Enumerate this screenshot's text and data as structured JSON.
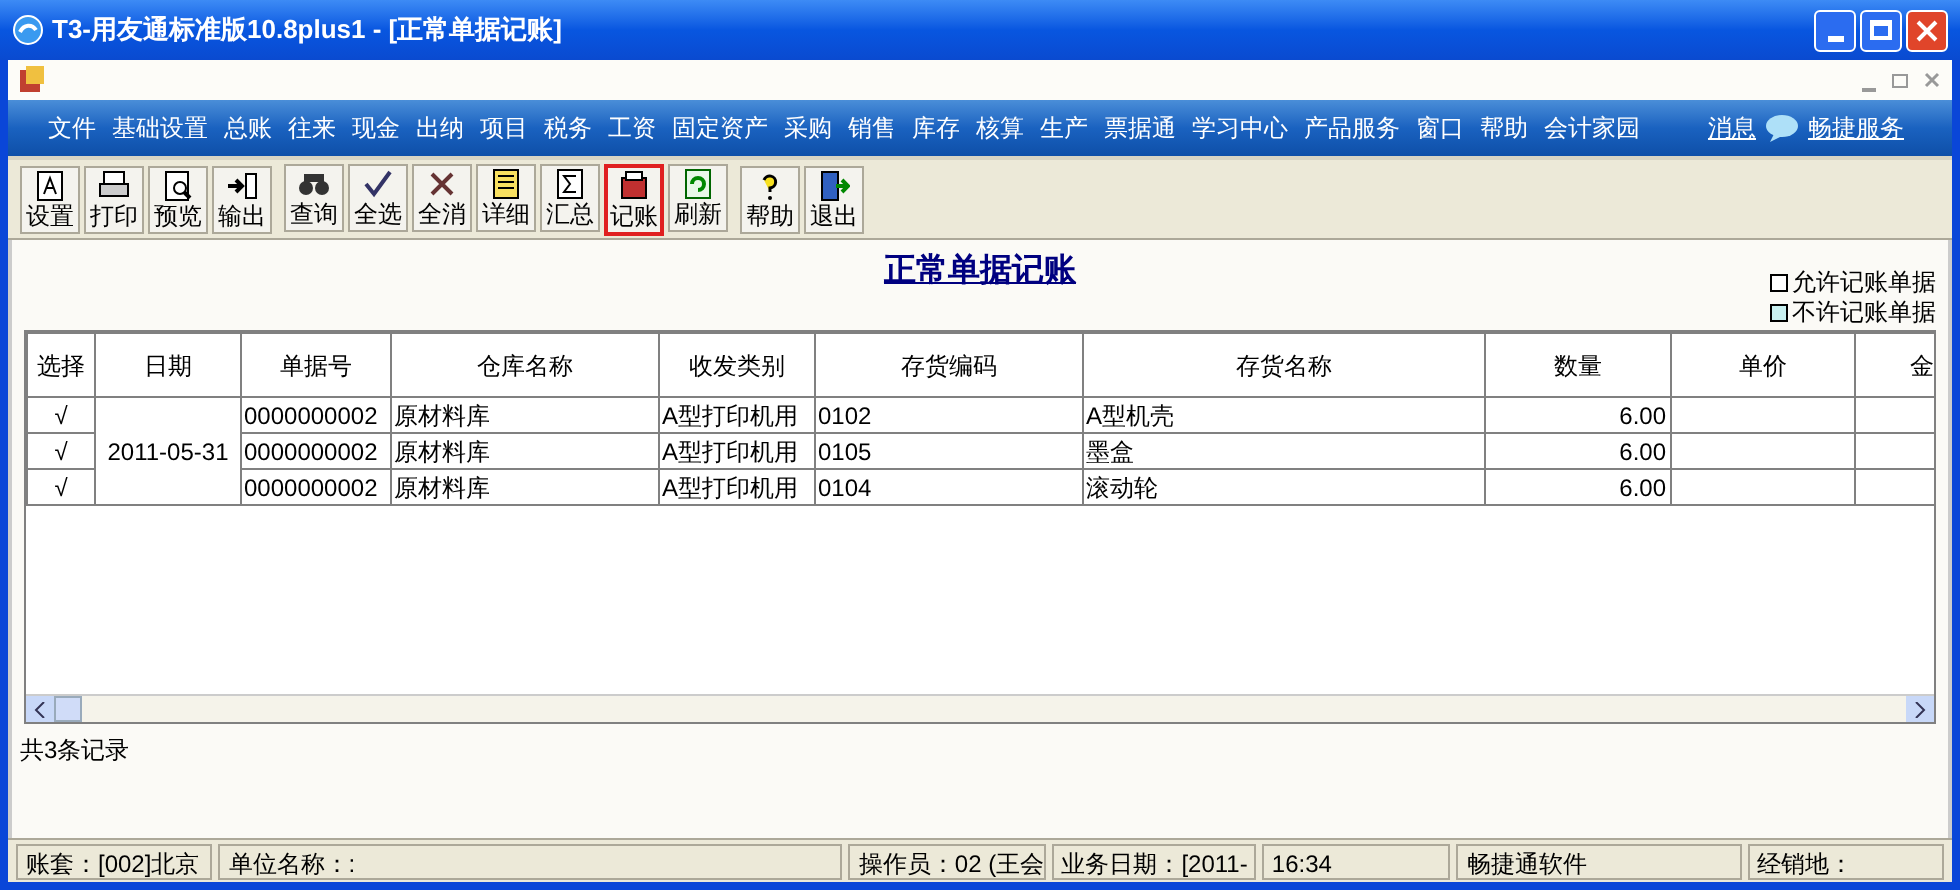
{
  "window": {
    "title": "T3-用友通标准版10.8plus1 - [正常单据记账]"
  },
  "menu": {
    "items": [
      "文件",
      "基础设置",
      "总账",
      "往来",
      "现金",
      "出纳",
      "项目",
      "税务",
      "工资",
      "固定资产",
      "采购",
      "销售",
      "库存",
      "核算",
      "生产",
      "票据通",
      "学习中心",
      "产品服务",
      "窗口",
      "帮助",
      "会计家园"
    ],
    "links": [
      "消息",
      "畅捷服务"
    ]
  },
  "toolbar": {
    "groups": [
      [
        {
          "label": "设置",
          "highlighted": false
        },
        {
          "label": "打印",
          "highlighted": false
        },
        {
          "label": "预览",
          "highlighted": false
        },
        {
          "label": "输出",
          "highlighted": false
        }
      ],
      [
        {
          "label": "查询",
          "highlighted": false
        },
        {
          "label": "全选",
          "highlighted": false
        },
        {
          "label": "全消",
          "highlighted": false
        },
        {
          "label": "详细",
          "highlighted": false
        },
        {
          "label": "汇总",
          "highlighted": false
        },
        {
          "label": "记账",
          "highlighted": true
        },
        {
          "label": "刷新",
          "highlighted": false
        }
      ],
      [
        {
          "label": "帮助",
          "highlighted": false
        },
        {
          "label": "退出",
          "highlighted": false
        }
      ]
    ]
  },
  "heading": "正常单据记账",
  "legend": [
    {
      "label": "允许记账单据",
      "color": "#ffffff"
    },
    {
      "label": "不许记账单据",
      "color": "#c8f0f0"
    }
  ],
  "table": {
    "columns": [
      "选择",
      "日期",
      "单据号",
      "仓库名称",
      "收发类别",
      "存货编码",
      "存货名称",
      "数量",
      "单价",
      "金"
    ],
    "date": "2011-05-31",
    "rows": [
      {
        "select": "√",
        "doc_no": "0000000002",
        "warehouse": "原材料库",
        "category": "A型打印机用",
        "code": "0102",
        "name": "A型机壳",
        "qty": "6.00"
      },
      {
        "select": "√",
        "doc_no": "0000000002",
        "warehouse": "原材料库",
        "category": "A型打印机用",
        "code": "0105",
        "name": "墨盒",
        "qty": "6.00"
      },
      {
        "select": "√",
        "doc_no": "0000000002",
        "warehouse": "原材料库",
        "category": "A型打印机用",
        "code": "0104",
        "name": "滚动轮",
        "qty": "6.00"
      }
    ]
  },
  "record_count": "共3条记录",
  "status_bar": [
    "账套：[002]北京",
    "单位名称：:",
    "操作员：02 (王会",
    "业务日期：[2011-",
    "16:34",
    "畅捷通软件",
    "经销地："
  ]
}
